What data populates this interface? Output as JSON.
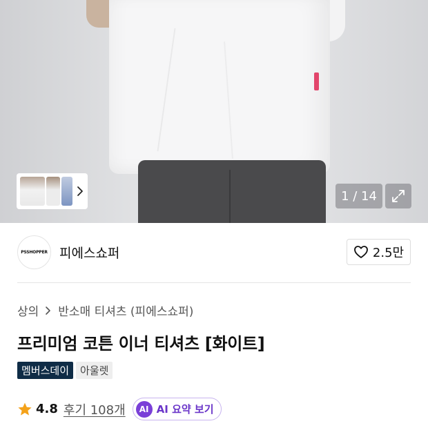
{
  "gallery": {
    "counter": "1 / 14",
    "thumbnails": [
      "model-front",
      "model-side",
      "detail"
    ]
  },
  "store": {
    "logo_text": "PSSHOPPER",
    "name": "피에스쇼퍼",
    "likes": "2.5만"
  },
  "breadcrumb": [
    "상의",
    "반소매 티셔츠 (피에스쇼퍼)"
  ],
  "product": {
    "title": "프리미엄 코튼 이너 티셔츠 [화이트]",
    "badges": [
      "멤버스데이",
      "아울렛"
    ]
  },
  "rating": {
    "score": "4.8",
    "reviews": "후기 108개",
    "ai_icon": "AI",
    "ai_label": "AI 요약 보기"
  },
  "colors": {
    "badge_dark": "#0f2c46",
    "star": "#f4a21a",
    "ai_purple": "#7a3fd8"
  }
}
